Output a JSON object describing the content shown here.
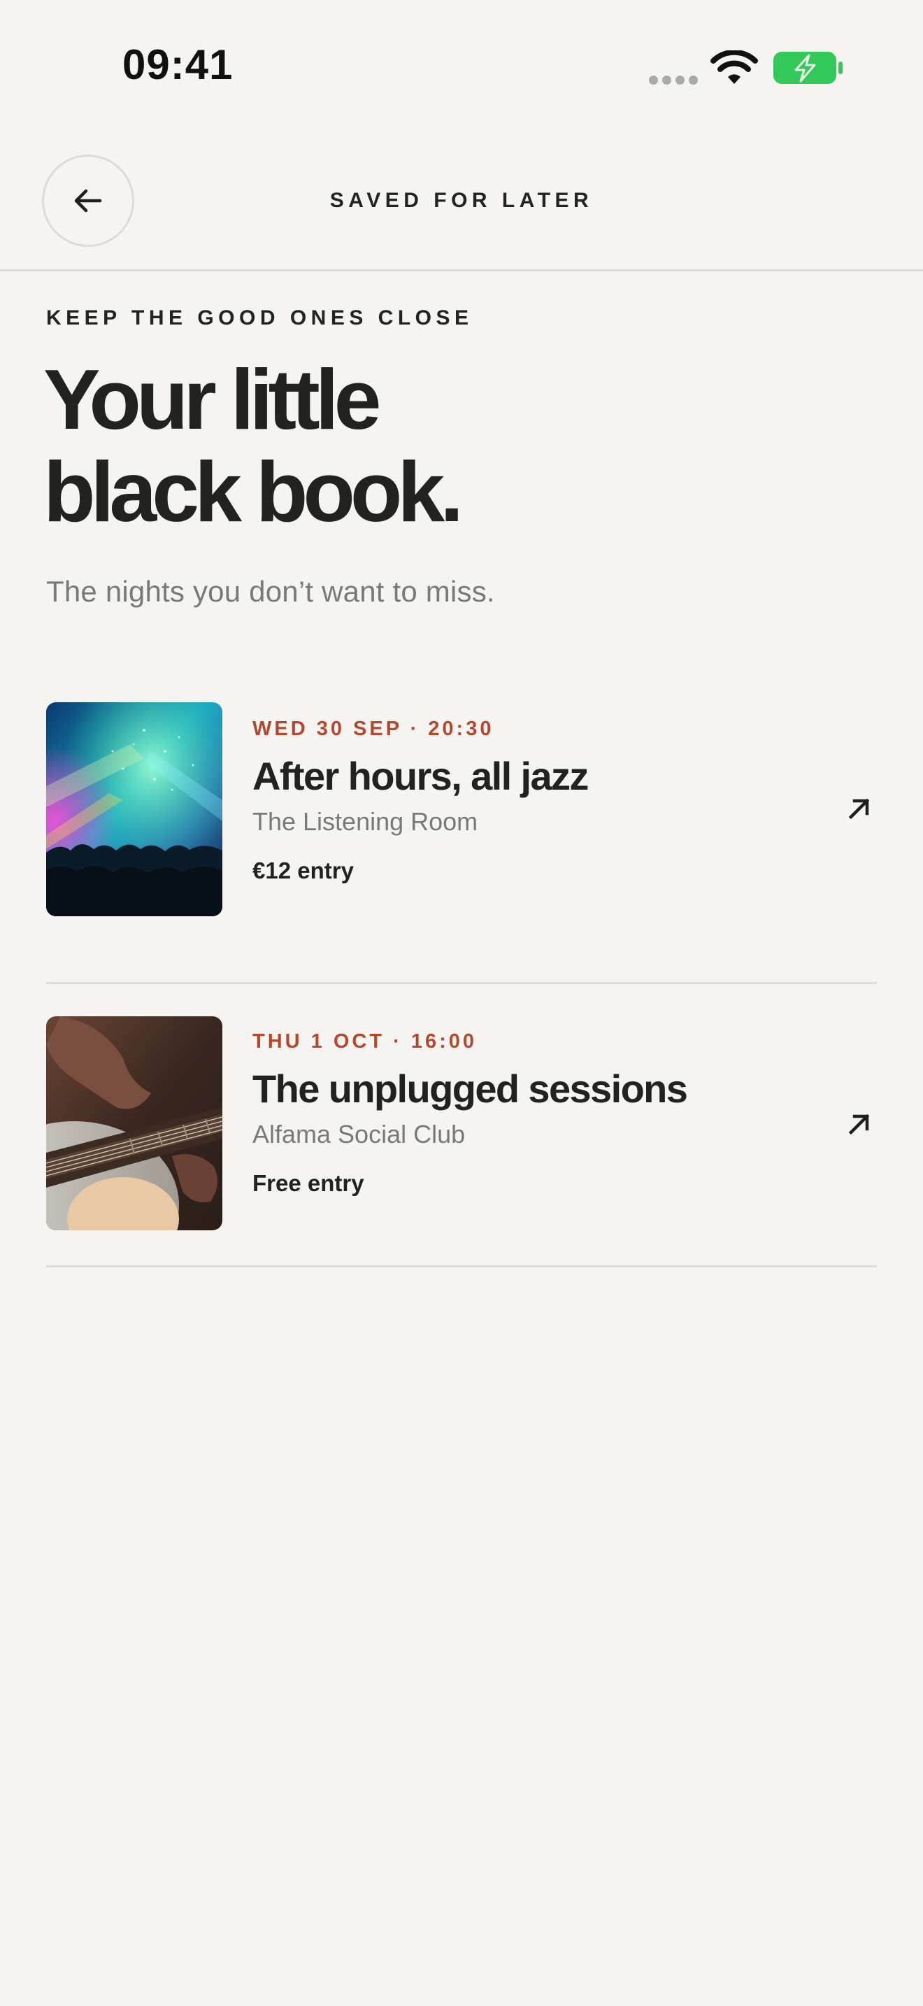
{
  "status_bar": {
    "time": "09:41",
    "icons": [
      "cellular-signal-icon",
      "wifi-icon",
      "battery-charging-icon"
    ],
    "battery_color": "#34c759"
  },
  "header": {
    "title": "SAVED FOR LATER",
    "back_icon": "arrow-left-icon"
  },
  "intro": {
    "eyebrow": "KEEP THE GOOD ONES CLOSE",
    "title_line1": "Your little",
    "title_line2": "black book.",
    "subtitle": "The nights you don’t want to miss."
  },
  "saved_events": [
    {
      "date": "WED 30 SEP · 20:30",
      "title": "After hours, all jazz",
      "venue": "The Listening Room",
      "price": "€12 entry",
      "image": "concert-crowd-stage-lights-photo",
      "action_icon": "arrow-up-right-icon"
    },
    {
      "date": "THU 1 OCT · 16:00",
      "title": "The unplugged sessions",
      "venue": "Alfama Social Club",
      "price": "Free entry",
      "image": "acoustic-guitar-close-up-photo",
      "action_icon": "arrow-up-right-icon"
    }
  ],
  "colors": {
    "background": "#f5f4f0",
    "text": "#22221e",
    "accent": "#b5472f",
    "muted": "#7a7a75",
    "divider": "#dedcd6"
  }
}
